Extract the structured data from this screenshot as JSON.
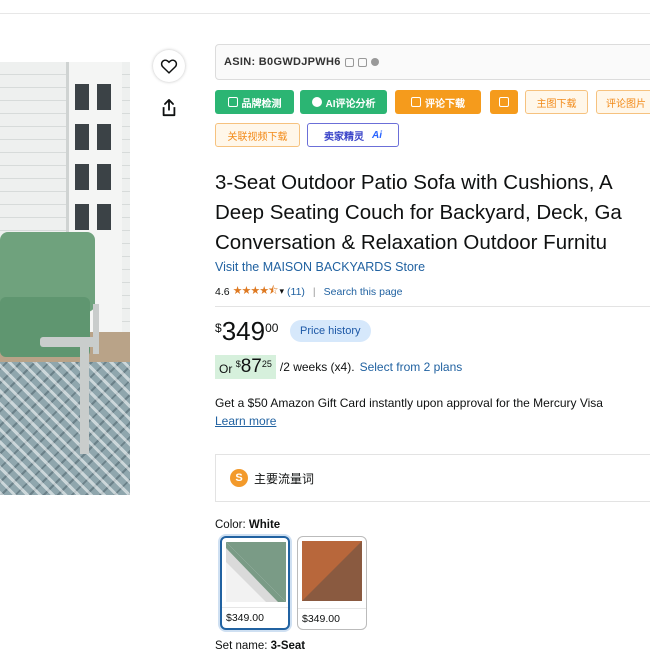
{
  "asin": {
    "label": "ASIN: B0GWDJPWH6"
  },
  "tools": {
    "brand_check": "品牌检测",
    "ai_review": "AI评论分析",
    "review_download": "评论下载",
    "main_image_download": "主图下载",
    "review_images": "评论图片",
    "related_video_download": "关联视频下载",
    "seller_ai": "卖家精灵",
    "seller_ai_mark": "Ai"
  },
  "product": {
    "title_line1": "3-Seat Outdoor Patio Sofa with Cushions, A",
    "title_line2": "Deep Seating Couch for Backyard, Deck, Ga",
    "title_line3": "Conversation & Relaxation Outdoor Furnitu",
    "store_link": "Visit the MAISON BACKYARDS Store",
    "rating": "4.6",
    "stars": "★★★★⯪",
    "review_count": "(11)",
    "search_page": "Search this page"
  },
  "price": {
    "symbol": "$",
    "whole": "349",
    "fraction": "00",
    "history_button": "Price history"
  },
  "installments": {
    "prefix": "Or",
    "symbol": "$",
    "whole": "87",
    "fraction": "25",
    "terms": "/2 weeks (x4).",
    "plans_link": "Select from 2 plans"
  },
  "promo": {
    "gift_text": "Get a $50 Amazon Gift Card instantly upon approval for the Mercury Visa",
    "learn_more": "Learn more"
  },
  "keywords": {
    "icon_glyph": "S",
    "label": "主要流量词"
  },
  "color": {
    "label": "Color:",
    "selected": "White",
    "options": [
      {
        "price": "$349.00",
        "color_a": "#7a9b86",
        "color_b": "#f2f2f2"
      },
      {
        "price": "$349.00",
        "color_a": "#b8673b",
        "color_b": "#7a5a45"
      }
    ]
  },
  "set_name": {
    "label": "Set name:",
    "value": "3-Seat"
  }
}
